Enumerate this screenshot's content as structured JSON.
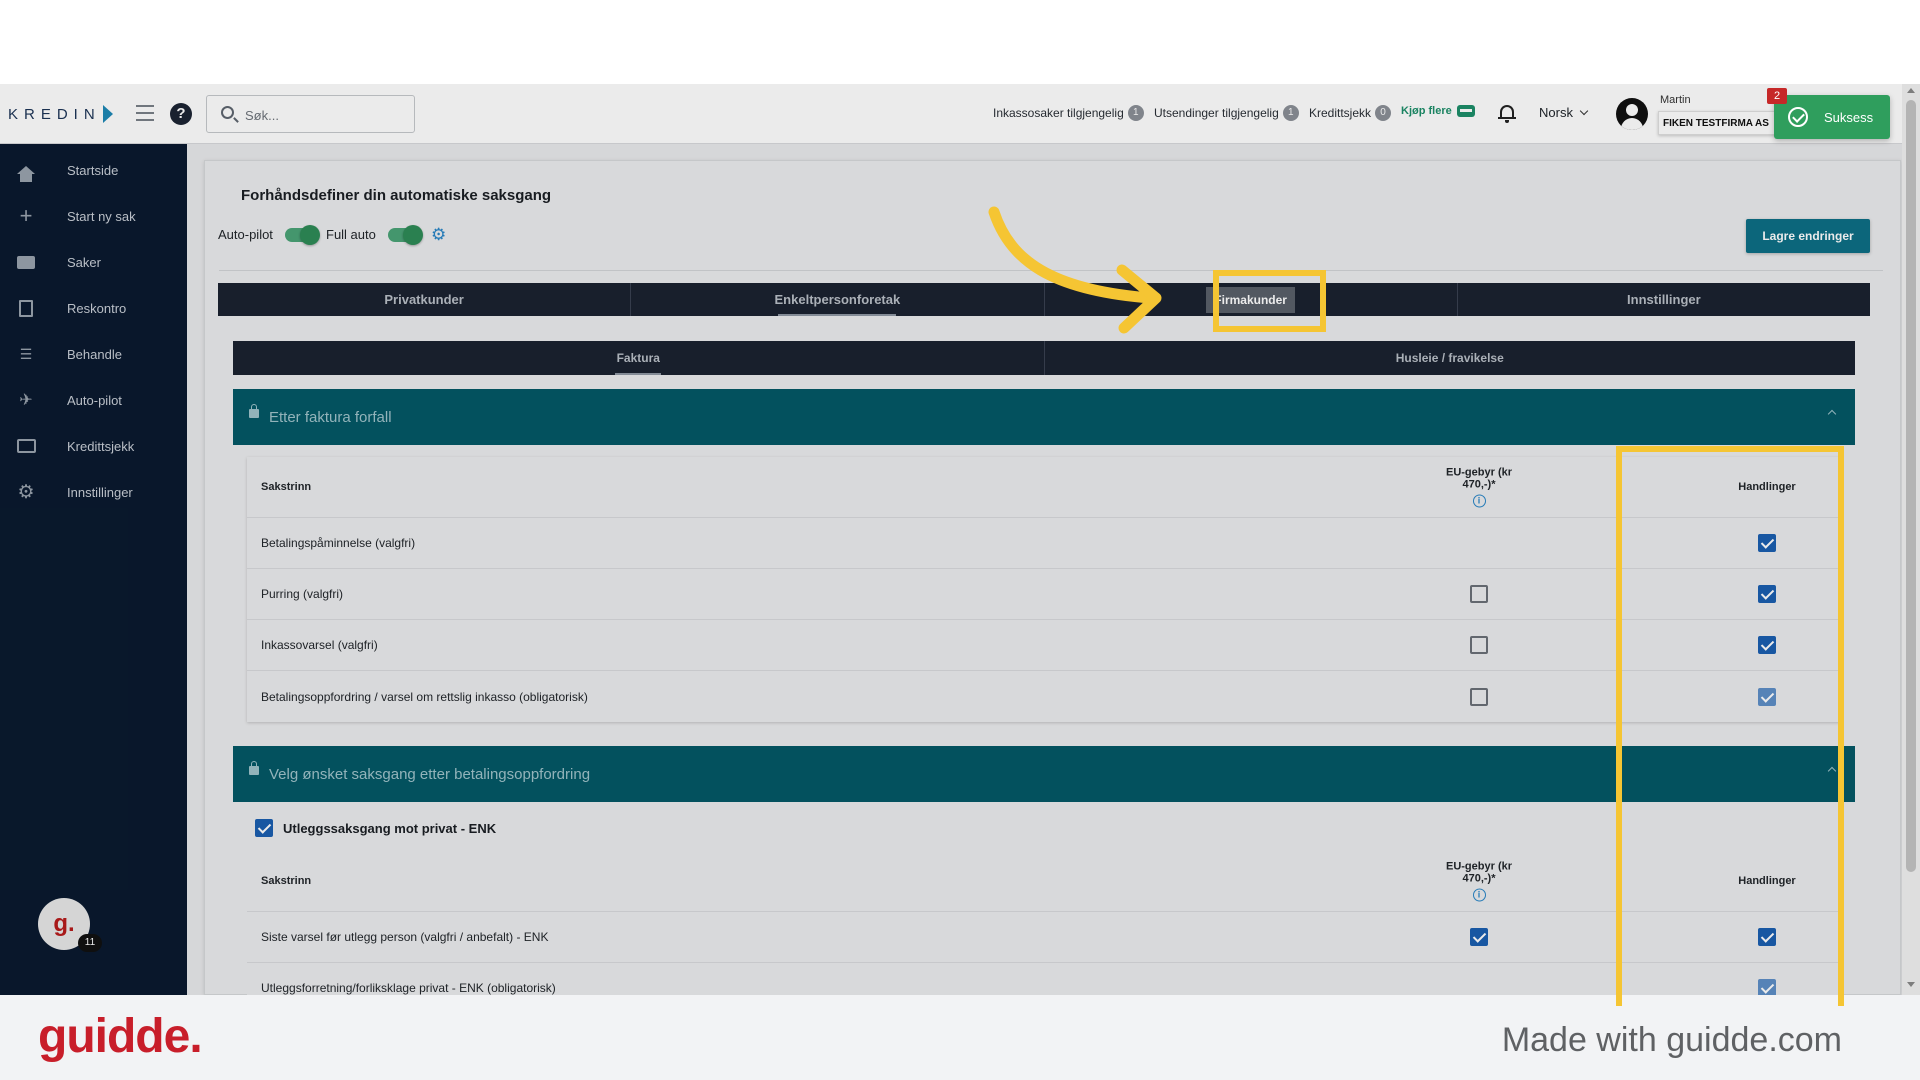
{
  "header": {
    "logo_text": "KREDIN",
    "search_placeholder": "Søk...",
    "stats": [
      {
        "label": "Inkassosaker tilgjengelig",
        "count": "1"
      },
      {
        "label": "Utsendinger tilgjengelig",
        "count": "1"
      },
      {
        "label": "Kredittsjekk",
        "count": "0"
      }
    ],
    "buy_more": "Kjøp flere",
    "language": "Norsk",
    "user_name": "Martin",
    "company": "FIKEN TESTFIRMA AS",
    "notification_count": "2",
    "toast": "Suksess"
  },
  "sidebar": {
    "items": [
      {
        "label": "Startside",
        "icon": "home-icon"
      },
      {
        "label": "Start ny sak",
        "icon": "plus-icon"
      },
      {
        "label": "Saker",
        "icon": "briefcase-icon"
      },
      {
        "label": "Reskontro",
        "icon": "document-icon"
      },
      {
        "label": "Behandle",
        "icon": "checklist-icon"
      },
      {
        "label": "Auto-pilot",
        "icon": "airplane-icon"
      },
      {
        "label": "Kredittsjekk",
        "icon": "id-card-icon"
      },
      {
        "label": "Innstillinger",
        "icon": "gear-icon"
      }
    ],
    "guidde_avatar": "g.",
    "guidde_count": "11"
  },
  "main": {
    "title": "Forhåndsdefiner din automatiske saksgang",
    "autopilot_label": "Auto-pilot",
    "fullauto_label": "Full auto",
    "save_label": "Lagre endringer",
    "tabs": [
      "Privatkunder",
      "Enkeltpersonforetak",
      "Firmakunder",
      "Innstillinger"
    ],
    "active_tab": "Enkeltpersonforetak",
    "highlighted_tab": "Firmakunder",
    "subtabs": [
      "Faktura",
      "Husleie / fravikelse"
    ],
    "section1": {
      "title": "Etter faktura forfall",
      "col_step": "Sakstrinn",
      "col_eu": "EU-gebyr (kr 470,-)*",
      "col_actions": "Handlinger",
      "rows": [
        {
          "step": "Betalingspåminnelse (valgfri)",
          "eu": null,
          "action": true
        },
        {
          "step": "Purring (valgfri)",
          "eu": false,
          "action": true
        },
        {
          "step": "Inkassovarsel (valgfri)",
          "eu": false,
          "action": true
        },
        {
          "step": "Betalingsoppfordring / varsel om rettslig inkasso (obligatorisk)",
          "eu": false,
          "action": true
        }
      ]
    },
    "section2": {
      "title": "Velg ønsket saksgang etter betalingsoppfordring",
      "option_label": "Utleggssaksgang mot privat - ENK",
      "col_step": "Sakstrinn",
      "col_eu": "EU-gebyr (kr 470,-)*",
      "col_actions": "Handlinger",
      "rows": [
        {
          "step": "Siste varsel før utlegg person (valgfri / anbefalt) - ENK",
          "eu": true,
          "action": true
        },
        {
          "step": "Utleggsforretning/forliksklage privat - ENK (obligatorisk)",
          "eu": null,
          "action": true
        }
      ]
    }
  },
  "footer": {
    "brand": "guidde.",
    "made_with": "Made with guidde.com"
  },
  "colors": {
    "sidebar": "#0a1a2f",
    "section_bar": "#045866",
    "highlight": "#f5c533",
    "checkbox": "#1b5fb0",
    "toast": "#2f9e5d"
  }
}
